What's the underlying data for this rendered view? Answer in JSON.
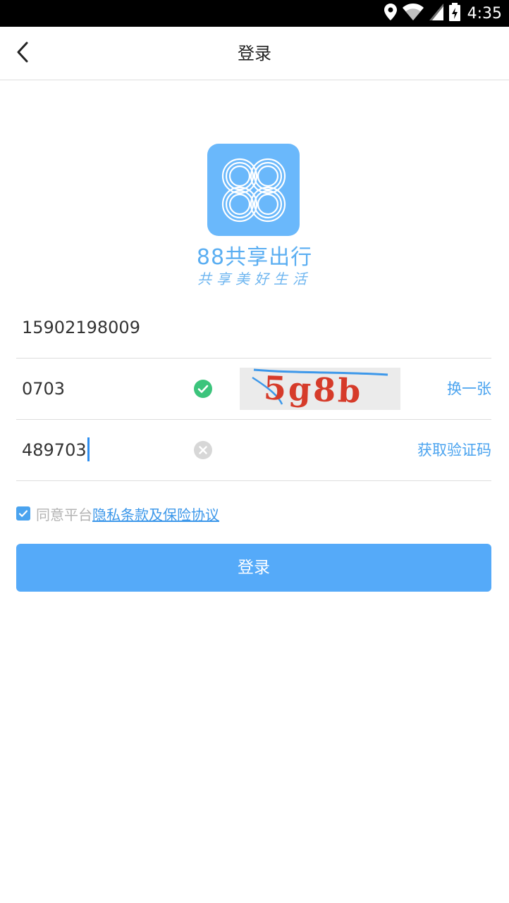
{
  "status_bar": {
    "time": "4:35",
    "icons": [
      "location-icon",
      "wifi-icon",
      "signal-icon",
      "battery-icon"
    ]
  },
  "nav": {
    "title": "登录",
    "back_icon": "chevron-left-icon"
  },
  "brand": {
    "name": "88共享出行",
    "slogan": "共享美好生活",
    "logo_color": "#6ab8fb"
  },
  "form": {
    "phone": {
      "value": "15902198009"
    },
    "captcha": {
      "value": "0703",
      "status": "valid",
      "image_text": "5g8b",
      "refresh_label": "换一张"
    },
    "sms_code": {
      "value": "489703",
      "clear_icon": "clear-icon",
      "get_code_label": "获取验证码"
    }
  },
  "agreement": {
    "checked": true,
    "prefix": "同意平台",
    "link": "隐私条款及保险协议"
  },
  "login_button": {
    "label": "登录"
  },
  "colors": {
    "accent": "#4aa3ef",
    "button": "#55aaf9",
    "success": "#3cc47c",
    "captcha_text": "#d63b2a"
  }
}
